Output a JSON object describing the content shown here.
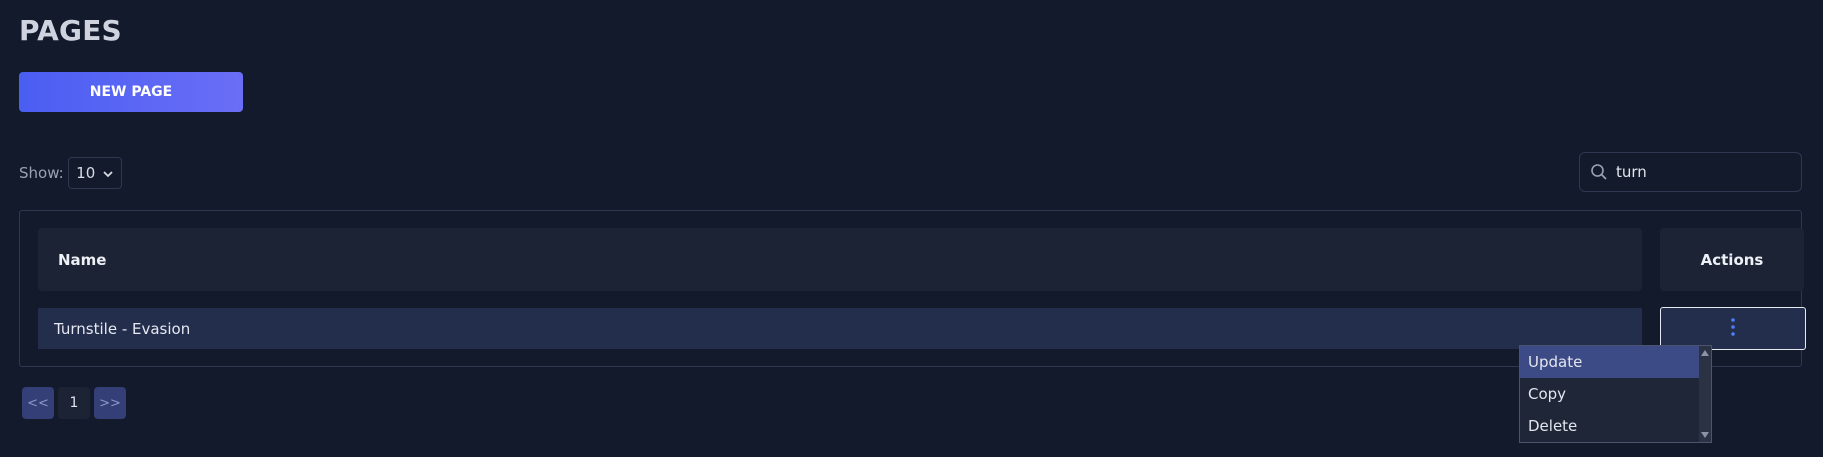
{
  "header": {
    "title": "PAGES",
    "new_page_label": "NEW PAGE"
  },
  "controls": {
    "show_label": "Show:",
    "page_size": "10",
    "search_value": "turn"
  },
  "table": {
    "columns": [
      "Name",
      "Actions"
    ],
    "rows": [
      {
        "name": "Turnstile - Evasion"
      }
    ]
  },
  "pagination": {
    "prev_label": "<<",
    "current_page": "1",
    "next_label": ">>"
  },
  "actions_menu": {
    "items": [
      "Update",
      "Copy",
      "Delete"
    ],
    "highlighted": "Update"
  },
  "colors": {
    "background": "#131a2b",
    "accent": "#4a5ef2",
    "row_highlight": "#232d4c",
    "menu_highlight": "#3c4a86",
    "kebab": "#4f7cf7"
  },
  "icons": {
    "search": "search-icon",
    "select_arrow": "chevron-down-icon",
    "row_actions": "kebab-menu-icon"
  }
}
